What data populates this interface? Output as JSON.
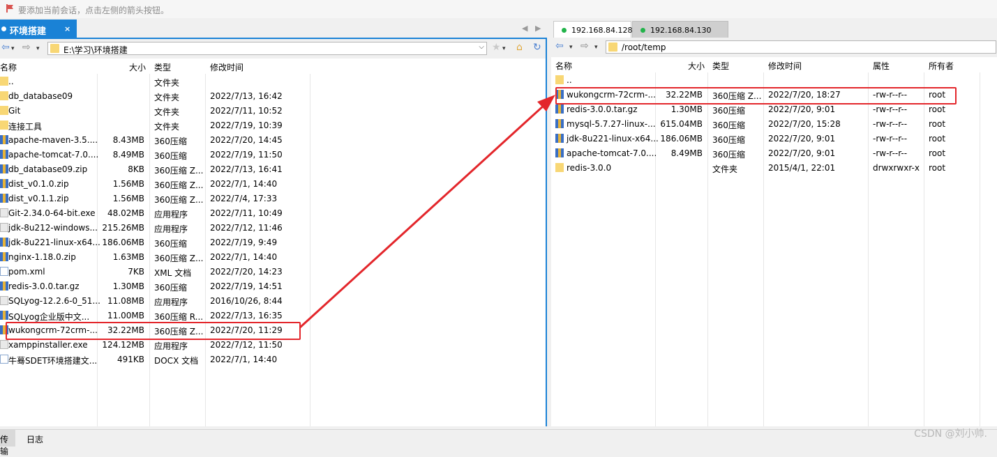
{
  "topbar": {
    "hint": "要添加当前会话，点击左侧的箭头按钮。"
  },
  "left": {
    "tab_label": "环境搭建",
    "tab_close": "×",
    "nav_prev": "◀",
    "nav_next": "▶",
    "path": "E:\\学习\\环境搭建",
    "headers": [
      "名称",
      "大小",
      "类型",
      "修改时间"
    ],
    "rows": [
      {
        "icon": "folder",
        "name": "..",
        "size": "",
        "type": "文件夹",
        "time": ""
      },
      {
        "icon": "folder",
        "name": "db_database09",
        "size": "",
        "type": "文件夹",
        "time": "2022/7/13, 16:42"
      },
      {
        "icon": "folder",
        "name": "Git",
        "size": "",
        "type": "文件夹",
        "time": "2022/7/11, 10:52"
      },
      {
        "icon": "folder",
        "name": "连接工具",
        "size": "",
        "type": "文件夹",
        "time": "2022/7/19, 10:39"
      },
      {
        "icon": "zip",
        "name": "apache-maven-3.5....",
        "size": "8.43MB",
        "type": "360压缩",
        "time": "2022/7/20, 14:45"
      },
      {
        "icon": "zip",
        "name": "apache-tomcat-7.0....",
        "size": "8.49MB",
        "type": "360压缩",
        "time": "2022/7/19, 11:50"
      },
      {
        "icon": "zip",
        "name": "db_database09.zip",
        "size": "8KB",
        "type": "360压缩 Z...",
        "time": "2022/7/13, 16:41"
      },
      {
        "icon": "zip",
        "name": "dist_v0.1.0.zip",
        "size": "1.56MB",
        "type": "360压缩 Z...",
        "time": "2022/7/1, 14:40"
      },
      {
        "icon": "zip",
        "name": "dist_v0.1.1.zip",
        "size": "1.56MB",
        "type": "360压缩 Z...",
        "time": "2022/7/4, 17:33"
      },
      {
        "icon": "exe",
        "name": "Git-2.34.0-64-bit.exe",
        "size": "48.02MB",
        "type": "应用程序",
        "time": "2022/7/11, 10:49"
      },
      {
        "icon": "exe",
        "name": "jdk-8u212-windows...",
        "size": "215.26MB",
        "type": "应用程序",
        "time": "2022/7/12, 11:46"
      },
      {
        "icon": "zip",
        "name": "jdk-8u221-linux-x64...",
        "size": "186.06MB",
        "type": "360压缩",
        "time": "2022/7/19, 9:49"
      },
      {
        "icon": "zip",
        "name": "nginx-1.18.0.zip",
        "size": "1.63MB",
        "type": "360压缩 Z...",
        "time": "2022/7/1, 14:40"
      },
      {
        "icon": "doc",
        "name": "pom.xml",
        "size": "7KB",
        "type": "XML 文档",
        "time": "2022/7/20, 14:23"
      },
      {
        "icon": "zip",
        "name": "redis-3.0.0.tar.gz",
        "size": "1.30MB",
        "type": "360压缩",
        "time": "2022/7/19, 14:51"
      },
      {
        "icon": "exe",
        "name": "SQLyog-12.2.6-0_51...",
        "size": "11.08MB",
        "type": "应用程序",
        "time": "2016/10/26, 8:44"
      },
      {
        "icon": "zip",
        "name": "SQLyog企业版中文...",
        "size": "11.00MB",
        "type": "360压缩 R...",
        "time": "2022/7/13, 16:35"
      },
      {
        "icon": "zip",
        "name": "wukongcrm-72crm-...",
        "size": "32.22MB",
        "type": "360压缩 Z...",
        "time": "2022/7/20, 11:29"
      },
      {
        "icon": "exe",
        "name": "xamppinstaller.exe",
        "size": "124.12MB",
        "type": "应用程序",
        "time": "2022/7/12, 11:50"
      },
      {
        "icon": "doc",
        "name": "牛蓦SDET环境搭建文...",
        "size": "491KB",
        "type": "DOCX 文档",
        "time": "2022/7/1, 14:40"
      }
    ]
  },
  "right": {
    "tabs": [
      {
        "label": "192.168.84.128"
      },
      {
        "label": "192.168.84.130"
      }
    ],
    "path": "/root/temp",
    "headers": [
      "名称",
      "大小",
      "类型",
      "修改时间",
      "属性",
      "所有者"
    ],
    "rows": [
      {
        "icon": "folder",
        "name": "..",
        "size": "",
        "type": "",
        "time": "",
        "attr": "",
        "owner": ""
      },
      {
        "icon": "zip",
        "name": "wukongcrm-72crm-...",
        "size": "32.22MB",
        "type": "360压缩 Z...",
        "time": "2022/7/20, 18:27",
        "attr": "-rw-r--r--",
        "owner": "root"
      },
      {
        "icon": "zip",
        "name": "redis-3.0.0.tar.gz",
        "size": "1.30MB",
        "type": "360压缩",
        "time": "2022/7/20, 9:01",
        "attr": "-rw-r--r--",
        "owner": "root"
      },
      {
        "icon": "zip",
        "name": "mysql-5.7.27-linux-...",
        "size": "615.04MB",
        "type": "360压缩",
        "time": "2022/7/20, 15:28",
        "attr": "-rw-r--r--",
        "owner": "root"
      },
      {
        "icon": "zip",
        "name": "jdk-8u221-linux-x64...",
        "size": "186.06MB",
        "type": "360压缩",
        "time": "2022/7/20, 9:01",
        "attr": "-rw-r--r--",
        "owner": "root"
      },
      {
        "icon": "zip",
        "name": "apache-tomcat-7.0....",
        "size": "8.49MB",
        "type": "360压缩",
        "time": "2022/7/20, 9:01",
        "attr": "-rw-r--r--",
        "owner": "root"
      },
      {
        "icon": "folder",
        "name": "redis-3.0.0",
        "size": "",
        "type": "文件夹",
        "time": "2015/4/1, 22:01",
        "attr": "drwxrwxr-x",
        "owner": "root"
      }
    ]
  },
  "statusbar": {
    "tabs": [
      "传输",
      "日志"
    ]
  },
  "watermark": "CSDN @刘小帅.",
  "colors": {
    "accent": "#1a82d6",
    "highlight": "#e3262b",
    "online": "#22b34a"
  }
}
